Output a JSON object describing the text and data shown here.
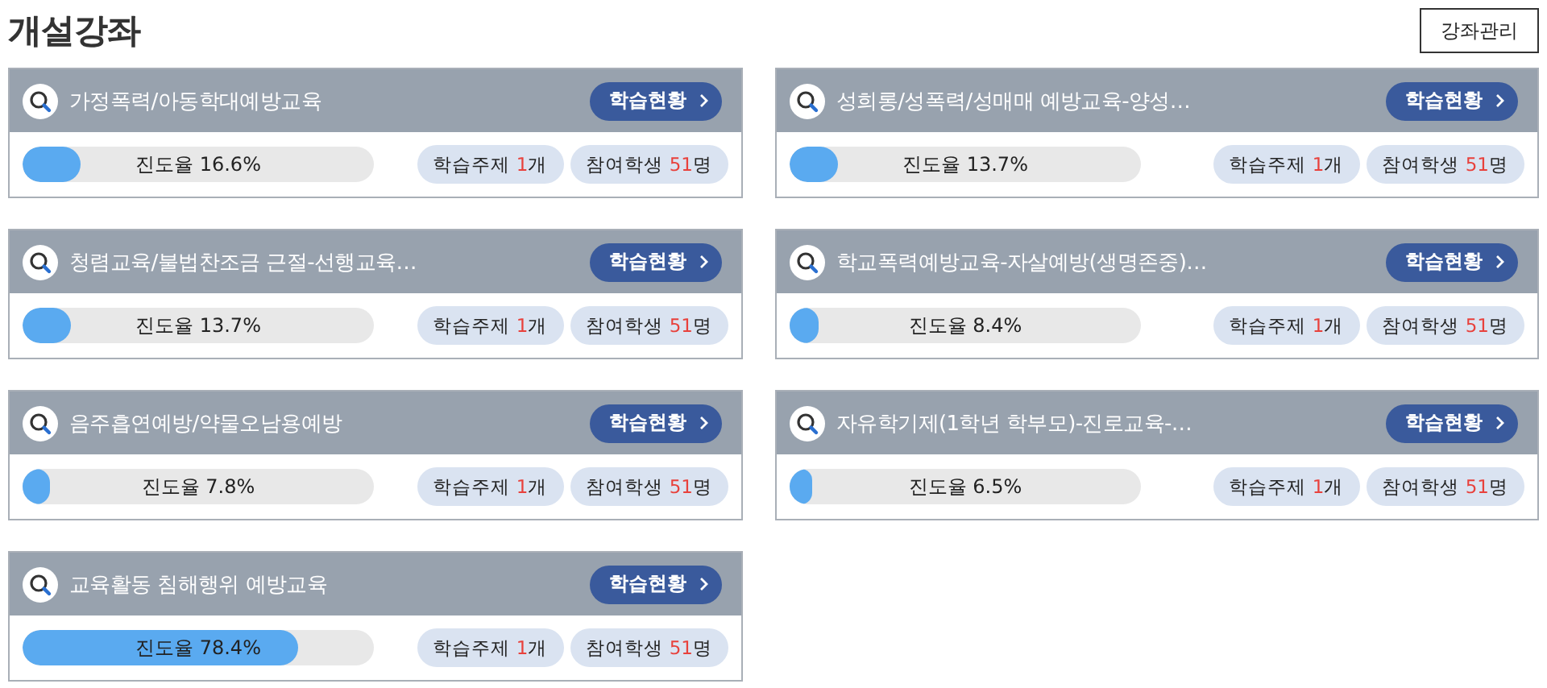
{
  "page_title": "개설강좌",
  "manage_button": "강좌관리",
  "courses": [
    {
      "title": "가정폭력/아동학대예방교육",
      "status_button": "학습현황",
      "progress_label": "진도율 16.6%",
      "level": 0.166,
      "topics": {
        "label": "학습주제",
        "count": "1",
        "unit": "개"
      },
      "students": {
        "label": "참여학생",
        "count": "51",
        "unit": "명"
      }
    },
    {
      "title": "성희롱/성폭력/성매매 예방교육-양성…",
      "status_button": "학습현황",
      "progress_label": "진도율 13.7%",
      "level": 0.137,
      "topics": {
        "label": "학습주제",
        "count": "1",
        "unit": "개"
      },
      "students": {
        "label": "참여학생",
        "count": "51",
        "unit": "명"
      }
    },
    {
      "title": "청렴교육/불법찬조금 근절-선행교육…",
      "status_button": "학습현황",
      "progress_label": "진도율 13.7%",
      "level": 0.137,
      "topics": {
        "label": "학습주제",
        "count": "1",
        "unit": "개"
      },
      "students": {
        "label": "참여학생",
        "count": "51",
        "unit": "명"
      }
    },
    {
      "title": "학교폭력예방교육-자살예방(생명존중)…",
      "status_button": "학습현황",
      "progress_label": "진도율 8.4%",
      "level": 0.084,
      "topics": {
        "label": "학습주제",
        "count": "1",
        "unit": "개"
      },
      "students": {
        "label": "참여학생",
        "count": "51",
        "unit": "명"
      }
    },
    {
      "title": "음주흡연예방/약물오남용예방",
      "status_button": "학습현황",
      "progress_label": "진도율 7.8%",
      "level": 0.078,
      "topics": {
        "label": "학습주제",
        "count": "1",
        "unit": "개"
      },
      "students": {
        "label": "참여학생",
        "count": "51",
        "unit": "명"
      }
    },
    {
      "title": "자유학기제(1학년 학부모)-진로교육-…",
      "status_button": "학습현황",
      "progress_label": "진도율 6.5%",
      "level": 0.065,
      "topics": {
        "label": "학습주제",
        "count": "1",
        "unit": "개"
      },
      "students": {
        "label": "참여학생",
        "count": "51",
        "unit": "명"
      }
    },
    {
      "title": "교육활동 침해행위 예방교육",
      "status_button": "학습현황",
      "progress_label": "진도율 78.4%",
      "level": 0.784,
      "topics": {
        "label": "학습주제",
        "count": "1",
        "unit": "개"
      },
      "students": {
        "label": "참여학생",
        "count": "51",
        "unit": "명"
      }
    }
  ]
}
